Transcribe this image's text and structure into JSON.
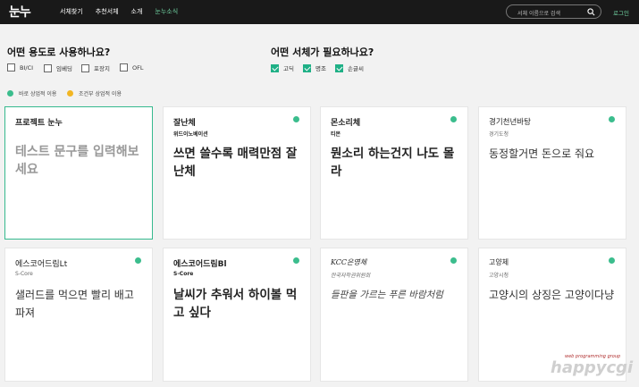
{
  "header": {
    "logo": "눈누",
    "nav": [
      "서체찾기",
      "추천서체",
      "소개",
      "눈누소식"
    ],
    "search_placeholder": "서체 이름으로 검색",
    "login": "로그인"
  },
  "filters": {
    "usage_question": "어떤 용도로 사용하나요?",
    "usage_options": [
      {
        "label": "BI/CI",
        "checked": false
      },
      {
        "label": "임베딩",
        "checked": false
      },
      {
        "label": "포장지",
        "checked": false
      },
      {
        "label": "OFL",
        "checked": false
      }
    ],
    "type_question": "어떤 서체가 필요하나요?",
    "type_options": [
      {
        "label": "고딕",
        "checked": true
      },
      {
        "label": "명조",
        "checked": true
      },
      {
        "label": "손글씨",
        "checked": true
      }
    ]
  },
  "legend": {
    "commercial": "바로 상업적 이용",
    "conditional": "조건부 상업적 이용",
    "commercial_color": "#3bbd8d",
    "conditional_color": "#f2b623"
  },
  "cards": [
    {
      "name": "프로젝트 눈누",
      "maker": "",
      "sample": "테스트 문구를 입력해보세요",
      "selected": true
    },
    {
      "name": "잘난체",
      "maker": "위드이노베이션",
      "sample": "쓰면 쓸수록 매력만점 잘난체"
    },
    {
      "name": "몬소리체",
      "maker": "티몬",
      "sample": "뭔소리 하는건지 나도 몰라"
    },
    {
      "name": "경기천년바탕",
      "maker": "경기도청",
      "sample": "동정할거면 돈으로 줘요"
    },
    {
      "name": "에스코어드림Lt",
      "maker": "S-Core",
      "sample": "샐러드를 먹으면 빨리 배고파져"
    },
    {
      "name": "에스코어드림Bl",
      "maker": "S-Core",
      "sample": "날씨가 추워서 하이볼 먹고 싶다"
    },
    {
      "name": "KCC은영체",
      "maker": "한국저작권위원회",
      "sample": "들판을 가르는 푸른 바람처럼"
    },
    {
      "name": "고양체",
      "maker": "고양시청",
      "sample": "고양시의 상징은 고양이다냥"
    }
  ],
  "watermark": {
    "main": "happycgi",
    "sub": "web programming group"
  }
}
